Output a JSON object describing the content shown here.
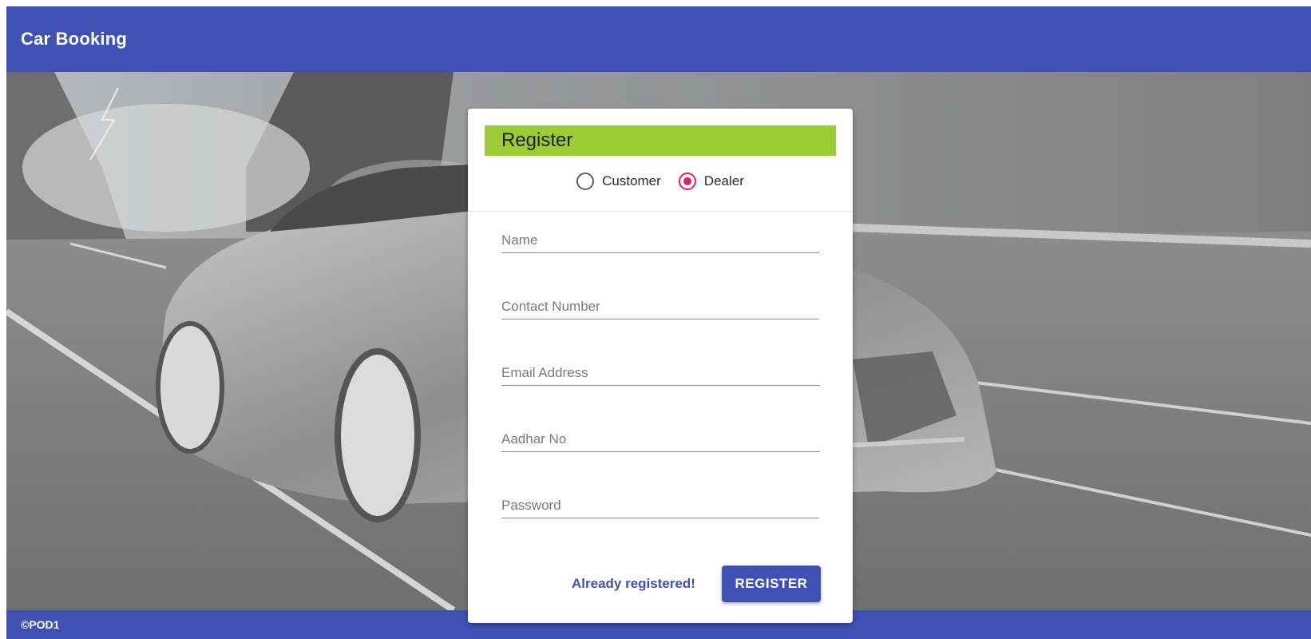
{
  "app": {
    "title": "Car Booking",
    "footer_text": "©POD1"
  },
  "register_form": {
    "heading": "Register",
    "heading_color": "#9acd32",
    "roles": [
      {
        "label": "Customer",
        "selected": false
      },
      {
        "label": "Dealer",
        "selected": true
      }
    ],
    "fields": {
      "name": {
        "placeholder": "Name",
        "value": ""
      },
      "contact": {
        "placeholder": "Contact Number",
        "value": ""
      },
      "email": {
        "placeholder": "Email Address",
        "value": ""
      },
      "aadhar": {
        "placeholder": "Aadhar No",
        "value": ""
      },
      "password": {
        "placeholder": "Password",
        "value": ""
      }
    },
    "already_registered_label": "Already registered!",
    "register_button_label": "REGISTER"
  },
  "colors": {
    "primary": "#3f51b5",
    "accent": "#e91e63",
    "header_green": "#9acd32"
  },
  "background": {
    "subject": "sports car on road",
    "icon": "car-image"
  }
}
